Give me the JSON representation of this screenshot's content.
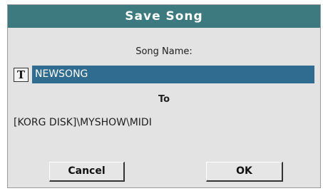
{
  "dialog": {
    "title": "Save Song",
    "song_name_label": "Song Name:",
    "text_edit_button": "T",
    "song_name_value": "NEWSONG",
    "to_label": "To",
    "destination_path": "[KORG DISK]\\MYSHOW\\MIDI",
    "cancel_label": "Cancel",
    "ok_label": "OK"
  },
  "colors": {
    "titlebar": "#3d7a7f",
    "field_highlight": "#2f6c8f",
    "panel": "#e3e3e3"
  }
}
